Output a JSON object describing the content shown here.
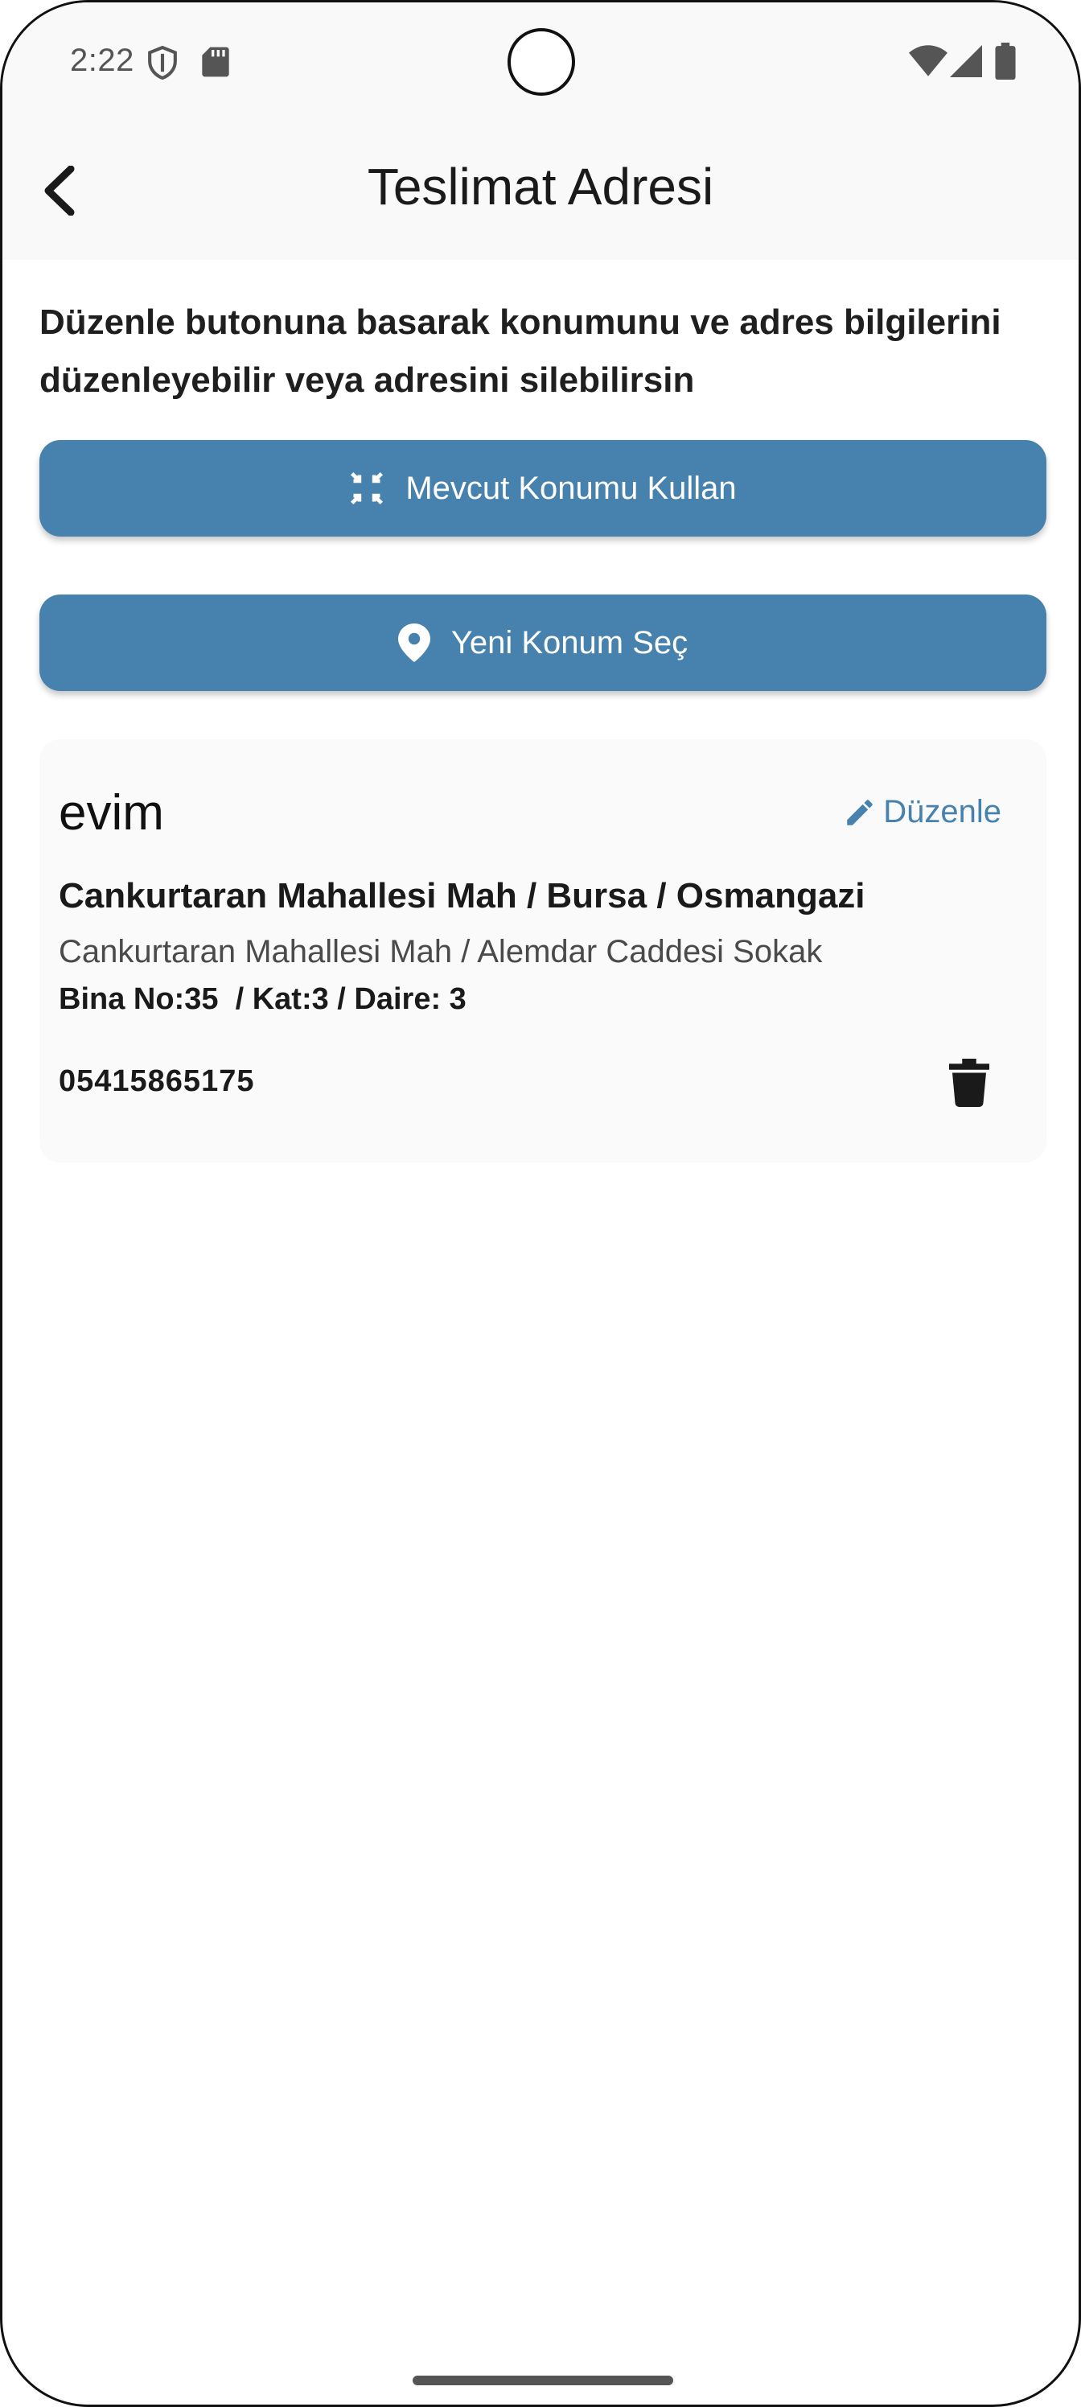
{
  "status_bar": {
    "time": "2:22",
    "icons": [
      "shield-icon",
      "sd-card-icon",
      "wifi-icon",
      "signal-icon",
      "battery-icon"
    ]
  },
  "app_bar": {
    "title": "Teslimat Adresi",
    "back_icon": "chevron-left-icon"
  },
  "main": {
    "info_text": "Düzenle butonuna basarak konumunu ve adres bilgilerini düzenleyebilir veya adresini silebilirsin",
    "use_current_location_label": "Mevcut Konumu Kullan",
    "select_new_location_label": "Yeni Konum Seç",
    "accent_color": "#4682ad"
  },
  "address_card": {
    "name": "evim",
    "edit_label": "Düzenle",
    "line1": "Cankurtaran Mahallesi Mah / Bursa / Osmangazi",
    "line2": "Cankurtaran Mahallesi Mah / Alemdar Caddesi Sokak",
    "line3": "Bina No:35  / Kat:3 / Daire: 3",
    "phone": "05415865175"
  }
}
